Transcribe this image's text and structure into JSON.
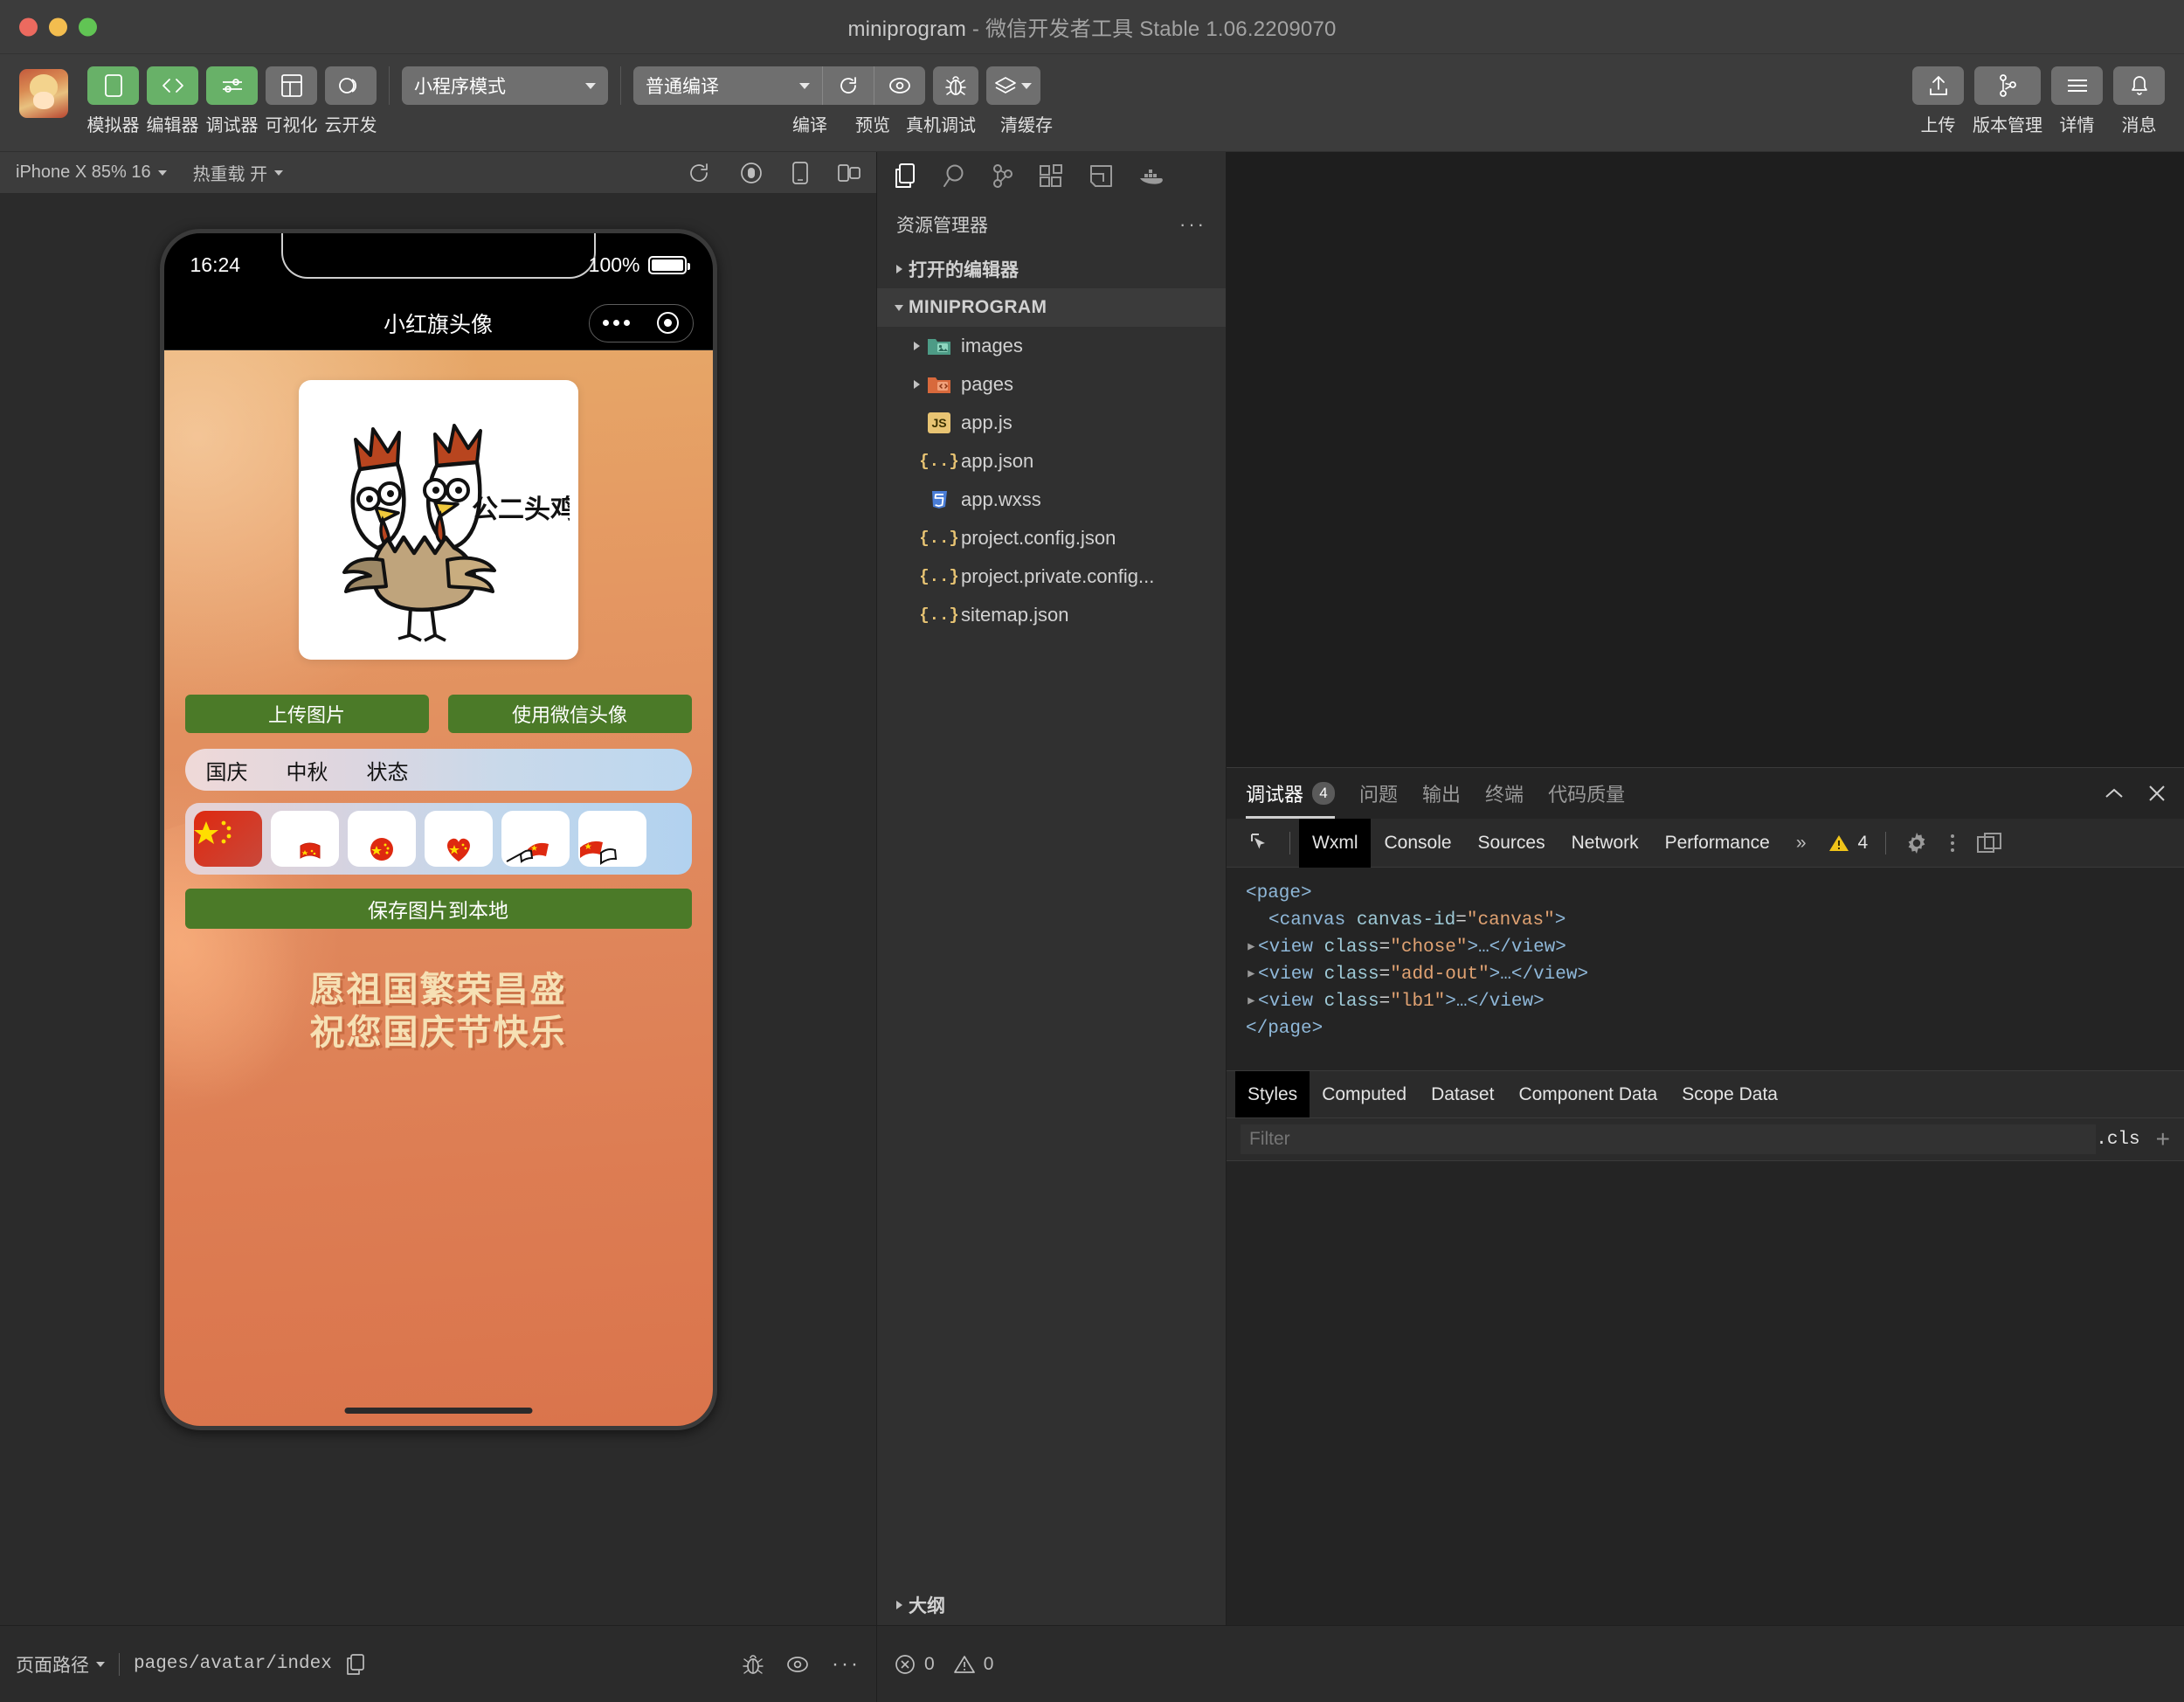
{
  "window": {
    "title_main": "miniprogram",
    "title_dash": " - ",
    "title_sub": "微信开发者工具 Stable 1.06.2209070"
  },
  "toolbar": {
    "items": [
      {
        "label": "模拟器",
        "icon": "phone-icon",
        "active": true
      },
      {
        "label": "编辑器",
        "icon": "code-icon",
        "active": true
      },
      {
        "label": "调试器",
        "icon": "debug-toggle-icon",
        "active": true
      },
      {
        "label": "可视化",
        "icon": "layout-icon",
        "active": false
      },
      {
        "label": "云开发",
        "icon": "cloud-icon",
        "active": false
      }
    ],
    "mode_select": "小程序模式",
    "compile_select": "普通编译",
    "actions": [
      {
        "label": "编译",
        "icon": "refresh-icon"
      },
      {
        "label": "预览",
        "icon": "eye-icon"
      },
      {
        "label": "真机调试",
        "icon": "bug-icon"
      },
      {
        "label": "清缓存",
        "icon": "layers-icon"
      }
    ],
    "right_actions": [
      {
        "label": "上传",
        "icon": "upload-icon"
      },
      {
        "label": "版本管理",
        "icon": "branch-icon"
      },
      {
        "label": "详情",
        "icon": "menu-icon"
      },
      {
        "label": "消息",
        "icon": "bell-icon"
      }
    ]
  },
  "simulator_bar": {
    "device": "iPhone X 85% 16",
    "hot_reload": "热重载 开",
    "icons": [
      "rotate-icon",
      "record-icon",
      "device-icon",
      "multiscreen-icon"
    ]
  },
  "phone": {
    "status": {
      "time": "16:24",
      "battery_percent": "100%"
    },
    "navbar_title": "小红旗头像",
    "avatar_caption": "公二头鸡",
    "buttons": {
      "upload": "上传图片",
      "use_wechat": "使用微信头像",
      "save": "保存图片到本地"
    },
    "tabs": [
      "国庆",
      "中秋",
      "状态"
    ],
    "thumbnails": [
      {
        "name": "flag-full",
        "selected": true
      },
      {
        "name": "flag-corner",
        "selected": false
      },
      {
        "name": "flag-circle",
        "selected": false
      },
      {
        "name": "flag-heart",
        "selected": false
      },
      {
        "name": "flag-hand",
        "selected": false
      },
      {
        "name": "flag-hand-2",
        "selected": false
      }
    ],
    "slogan_line1": "愿祖国繁荣昌盛",
    "slogan_line2": "祝您国庆节快乐"
  },
  "explorer": {
    "activity_icons": [
      "files-icon",
      "search-icon",
      "source-control-icon",
      "extensions-icon",
      "layout-editor-icon",
      "docker-icon"
    ],
    "title": "资源管理器",
    "more": "···",
    "sections": [
      {
        "label": "打开的编辑器",
        "expanded": false,
        "bold": false
      },
      {
        "label": "MINIPROGRAM",
        "expanded": true,
        "bold": true
      }
    ],
    "files": [
      {
        "name": "images",
        "type": "folder",
        "icon": "folder-images-icon",
        "expanded": false
      },
      {
        "name": "pages",
        "type": "folder",
        "icon": "folder-pages-icon",
        "expanded": false
      },
      {
        "name": "app.js",
        "type": "js",
        "icon": "js-icon"
      },
      {
        "name": "app.json",
        "type": "json",
        "icon": "json-icon"
      },
      {
        "name": "app.wxss",
        "type": "wxss",
        "icon": "css-icon"
      },
      {
        "name": "project.config.json",
        "type": "json",
        "icon": "json-icon"
      },
      {
        "name": "project.private.config...",
        "type": "json",
        "icon": "json-icon"
      },
      {
        "name": "sitemap.json",
        "type": "json",
        "icon": "json-icon"
      }
    ],
    "outline": "大纲"
  },
  "debugger": {
    "panel_tabs": [
      {
        "label": "调试器",
        "badge": "4",
        "active": true
      },
      {
        "label": "问题",
        "badge": "",
        "active": false
      },
      {
        "label": "输出",
        "badge": "",
        "active": false
      },
      {
        "label": "终端",
        "badge": "",
        "active": false
      },
      {
        "label": "代码质量",
        "badge": "",
        "active": false
      }
    ],
    "collapse_icon": "chevron-up-icon",
    "close_icon": "close-icon",
    "devtool_tabs": [
      "Wxml",
      "Console",
      "Sources",
      "Network",
      "Performance"
    ],
    "devtool_active": "Wxml",
    "overflow": "»",
    "warning_count": "4",
    "wxml_lines": [
      {
        "indent": 0,
        "arrow": false,
        "text": "<page>",
        "kind": "tag"
      },
      {
        "indent": 1,
        "arrow": false,
        "parts": [
          {
            "t": "<canvas ",
            "c": "tag"
          },
          {
            "t": "canvas-id",
            "c": "attr"
          },
          {
            "t": "=",
            "c": "pun"
          },
          {
            "t": "\"canvas\"",
            "c": "val"
          },
          {
            "t": ">",
            "c": "tag"
          }
        ]
      },
      {
        "indent": 0,
        "arrow": true,
        "parts": [
          {
            "t": "<view ",
            "c": "tag"
          },
          {
            "t": "class",
            "c": "attr"
          },
          {
            "t": "=",
            "c": "pun"
          },
          {
            "t": "\"chose\"",
            "c": "val"
          },
          {
            "t": ">…</view>",
            "c": "tag"
          }
        ]
      },
      {
        "indent": 0,
        "arrow": true,
        "parts": [
          {
            "t": "<view ",
            "c": "tag"
          },
          {
            "t": "class",
            "c": "attr"
          },
          {
            "t": "=",
            "c": "pun"
          },
          {
            "t": "\"add-out\"",
            "c": "val"
          },
          {
            "t": ">…</view>",
            "c": "tag"
          }
        ]
      },
      {
        "indent": 0,
        "arrow": true,
        "parts": [
          {
            "t": "<view ",
            "c": "tag"
          },
          {
            "t": "class",
            "c": "attr"
          },
          {
            "t": "=",
            "c": "pun"
          },
          {
            "t": "\"lb1\"",
            "c": "val"
          },
          {
            "t": ">…</view>",
            "c": "tag"
          }
        ]
      },
      {
        "indent": 0,
        "arrow": false,
        "text": "</page>",
        "kind": "tag"
      }
    ],
    "style_tabs": [
      "Styles",
      "Computed",
      "Dataset",
      "Component Data",
      "Scope Data"
    ],
    "style_active": "Styles",
    "filter_placeholder": "Filter",
    "cls_label": ".cls",
    "plus_label": "+"
  },
  "footer": {
    "path_label": "页面路径",
    "page_path": "pages/avatar/index",
    "copy_icon": "copy-icon",
    "icons": [
      "bug-icon",
      "eye-icon",
      "more-icon"
    ],
    "outline_label": "大纲",
    "error_count": "0",
    "warning_count": "0"
  },
  "colors": {
    "accent_green": "#68b168",
    "button_green": "#4b7a28",
    "page_orange": "#e08a5e",
    "slogan_cream": "#f6e0b4",
    "flag_red": "#de2910",
    "warning_yellow": "#f0c419"
  }
}
